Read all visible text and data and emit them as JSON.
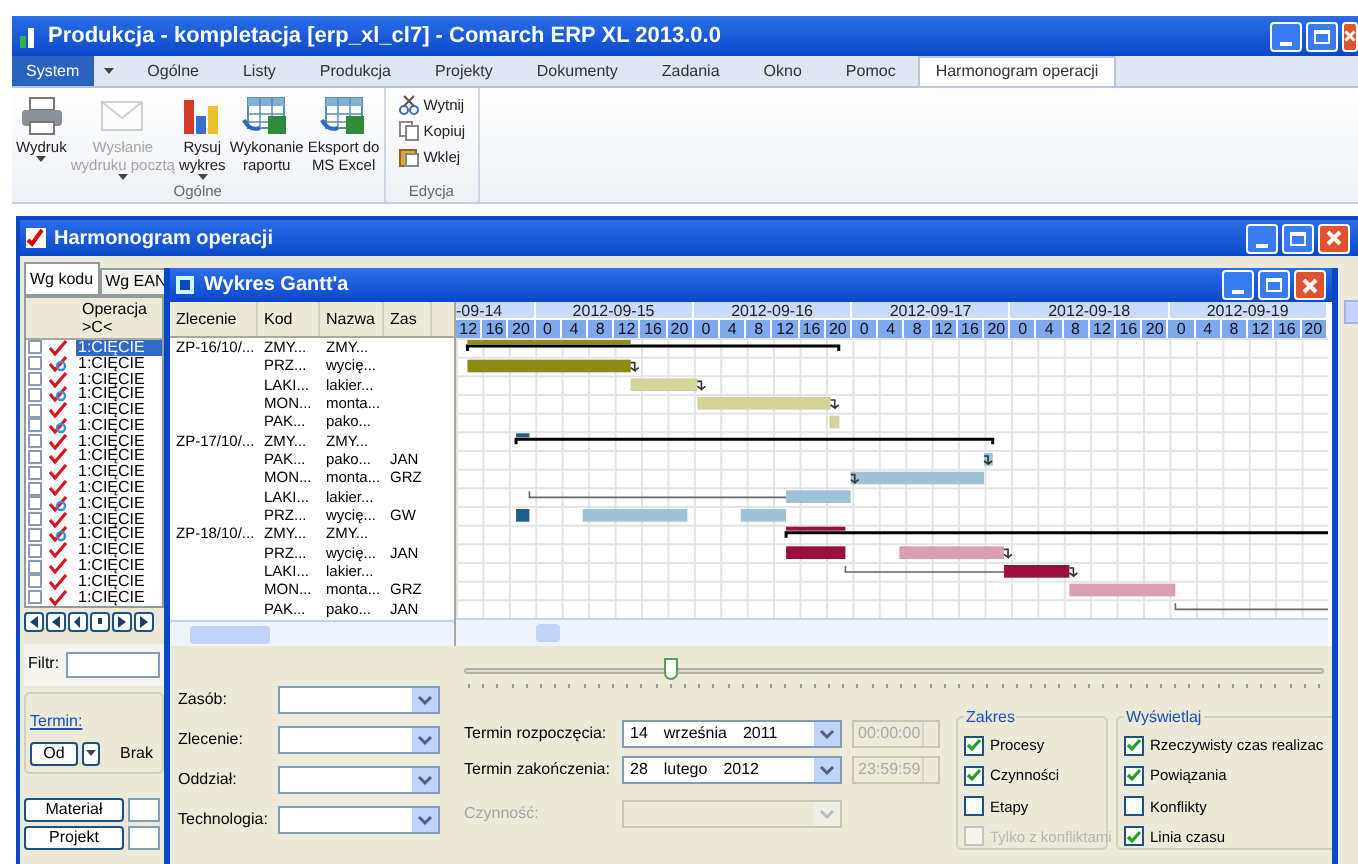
{
  "window": {
    "title": "Produkcja - kompletacja [erp_xl_cl7] - Comarch ERP XL 2013.0.0"
  },
  "app_button": "System",
  "menu": [
    {
      "label": "Ogólne",
      "selected": false
    },
    {
      "label": "Listy",
      "selected": false
    },
    {
      "label": "Produkcja",
      "selected": false
    },
    {
      "label": "Projekty",
      "selected": false
    },
    {
      "label": "Dokumenty",
      "selected": false
    },
    {
      "label": "Zadania",
      "selected": false
    },
    {
      "label": "Okno",
      "selected": false
    },
    {
      "label": "Pomoc",
      "selected": false
    },
    {
      "label": "Harmonogram operacji",
      "selected": true
    }
  ],
  "ribbon": {
    "groups": [
      {
        "name": "Ogólne",
        "buttons": [
          {
            "lines": [
              "Wydruk"
            ],
            "dropdown": true,
            "disabled": false
          },
          {
            "lines": [
              "Wysłanie",
              "wydruku pocztą"
            ],
            "dropdown": true,
            "disabled": true
          },
          {
            "lines": [
              "Rysuj",
              "wykres"
            ],
            "dropdown": true,
            "disabled": false
          },
          {
            "lines": [
              "Wykonanie",
              "raportu"
            ],
            "dropdown": false,
            "disabled": false
          },
          {
            "lines": [
              "Eksport do",
              "MS Excel"
            ],
            "dropdown": false,
            "disabled": false
          }
        ]
      },
      {
        "name": "Edycja",
        "small_buttons": [
          {
            "label": "Wytnij"
          },
          {
            "label": "Kopiuj"
          },
          {
            "label": "Wklej"
          }
        ]
      }
    ]
  },
  "operations_window": {
    "title": "Harmonogram operacji",
    "tabs": [
      {
        "label": "Wg kodu",
        "selected": true
      },
      {
        "label": "Wg EAN",
        "selected": false
      }
    ],
    "column_title": "Operacja",
    "column_filter": ">C<",
    "rows": [
      {
        "text": "1:CIĘCIE",
        "kind": "check",
        "checked": false,
        "selected": true
      },
      {
        "text": "1:CIĘCIE",
        "kind": "linked",
        "checked": false,
        "selected": false
      },
      {
        "text": "1:CIĘCIE",
        "kind": "check",
        "checked": false,
        "selected": false
      },
      {
        "text": "1:CIĘCIE",
        "kind": "linked",
        "checked": false,
        "selected": false
      },
      {
        "text": "1:CIĘCIE",
        "kind": "check",
        "checked": false,
        "selected": false
      },
      {
        "text": "1:CIĘCIE",
        "kind": "linked",
        "checked": false,
        "selected": false
      },
      {
        "text": "1:CIĘCIE",
        "kind": "check",
        "checked": false,
        "selected": false
      },
      {
        "text": "1:CIĘCIE",
        "kind": "check",
        "checked": false,
        "selected": false
      },
      {
        "text": "1:CIĘCIE",
        "kind": "check",
        "checked": false,
        "selected": false
      },
      {
        "text": "1:CIĘCIE",
        "kind": "check",
        "checked": false,
        "selected": false
      },
      {
        "text": "1:CIĘCIE",
        "kind": "linked",
        "checked": false,
        "selected": false
      },
      {
        "text": "1:CIĘCIE",
        "kind": "check",
        "checked": false,
        "selected": false
      },
      {
        "text": "1:CIĘCIE",
        "kind": "linked",
        "checked": false,
        "selected": false
      },
      {
        "text": "1:CIĘCIE",
        "kind": "check",
        "checked": false,
        "selected": false
      },
      {
        "text": "1:CIĘCIE",
        "kind": "check",
        "checked": false,
        "selected": false
      },
      {
        "text": "1:CIĘCIE",
        "kind": "check",
        "checked": false,
        "selected": false
      },
      {
        "text": "1:CIĘCIE",
        "kind": "check",
        "checked": false,
        "selected": false
      }
    ],
    "filter_label": "Filtr:",
    "term_label": "Termin:",
    "from_button": "Od",
    "term_value": "Brak",
    "buttons": [
      "Materiał",
      "Projekt"
    ]
  },
  "gantt": {
    "title": "Wykres Gantt'a",
    "columns": [
      "Zlecenie",
      "Kod",
      "Nazwa",
      "Zas"
    ],
    "rows": [
      {
        "order": "ZP-16/10/...",
        "code": "ZMY...",
        "name": "ZMY..."
      },
      {
        "code": "PRZ...",
        "name": "wycię..."
      },
      {
        "code": "LAKI...",
        "name": "lakier..."
      },
      {
        "code": "MON...",
        "name": "monta..."
      },
      {
        "code": "PAK...",
        "name": "pako..."
      },
      {
        "order": "ZP-17/10/...",
        "code": "ZMY...",
        "name": "ZMY..."
      },
      {
        "code": "PAK...",
        "name": "pako...",
        "resource": "JAN"
      },
      {
        "code": "MON...",
        "name": "monta...",
        "resource": "GRZ"
      },
      {
        "code": "LAKI...",
        "name": "lakier..."
      },
      {
        "code": "PRZ...",
        "name": "wycię...",
        "resource": "GW"
      },
      {
        "order": "ZP-18/10/...",
        "code": "ZMY...",
        "name": "ZMY..."
      },
      {
        "code": "PRZ...",
        "name": "wycię...",
        "resource": "JAN"
      },
      {
        "code": "LAKI...",
        "name": "lakier..."
      },
      {
        "code": "MON...",
        "name": "monta...",
        "resource": "GRZ"
      },
      {
        "code": "PAK...",
        "name": "pako...",
        "resource": "JAN"
      }
    ],
    "days": [
      "-09-14",
      "2012-09-15",
      "2012-09-16",
      "2012-09-17",
      "2012-09-18",
      "2012-09-19"
    ],
    "hours": [
      "12",
      "16",
      "20",
      "0",
      "4",
      "8",
      "12",
      "16",
      "20",
      "0",
      "4",
      "8",
      "12",
      "16",
      "20",
      "0",
      "4",
      "8",
      "12",
      "16",
      "20",
      "0",
      "4",
      "8",
      "12",
      "16",
      "20",
      "0",
      "4",
      "8",
      "12",
      "16",
      "20"
    ],
    "zoom": {
      "level": 0.24
    },
    "filters": [
      {
        "label": "Zasób:"
      },
      {
        "label": "Zlecenie:"
      },
      {
        "label": "Oddział:"
      },
      {
        "label": "Technologia:"
      }
    ],
    "start": {
      "label": "Termin rozpoczęcia:",
      "day": "14",
      "month": "września",
      "year": "2011",
      "time": "00:00:00"
    },
    "end": {
      "label": "Termin zakończenia:",
      "day": "28",
      "month": "lutego",
      "year": "2012",
      "time": "23:59:59"
    },
    "activity": {
      "label": "Czynność:",
      "disabled": true
    },
    "groups": [
      {
        "title": "Zakres",
        "options": [
          {
            "label": "Procesy",
            "checked": true,
            "disabled": false
          },
          {
            "label": "Czynności",
            "checked": true,
            "disabled": false
          },
          {
            "label": "Etapy",
            "checked": false,
            "disabled": false
          },
          {
            "label": "Tylko z konfliktami",
            "checked": false,
            "disabled": true
          }
        ]
      },
      {
        "title": "Wyświetlaj",
        "options": [
          {
            "label": "Rzeczywisty czas realizac",
            "checked": true,
            "disabled": false
          },
          {
            "label": "Powiązania",
            "checked": true,
            "disabled": false
          },
          {
            "label": "Konflikty",
            "checked": false,
            "disabled": false
          },
          {
            "label": "Linia czasu",
            "checked": true,
            "disabled": false
          }
        ]
      }
    ]
  }
}
